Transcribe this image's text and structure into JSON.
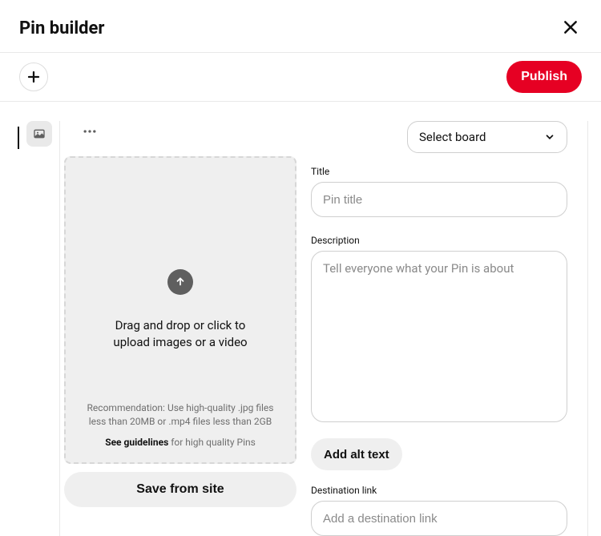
{
  "header": {
    "title": "Pin builder"
  },
  "toolbar": {
    "publish_label": "Publish"
  },
  "board_select": {
    "label": "Select board"
  },
  "fields": {
    "title_label": "Title",
    "title_placeholder": "Pin title",
    "title_value": "",
    "description_label": "Description",
    "description_placeholder": "Tell everyone what your Pin is about",
    "description_value": "",
    "alt_text_label": "Add alt text",
    "destination_label": "Destination link",
    "destination_placeholder": "Add a destination link",
    "destination_value": ""
  },
  "dropzone": {
    "main_text": "Drag and drop or click to upload images or a video",
    "recommendation": "Recommendation: Use high-quality .jpg files less than 20MB or .mp4 files less than 2GB",
    "guidelines_strong": "See guidelines",
    "guidelines_rest": " for high quality Pins"
  },
  "save_from_site_label": "Save from site"
}
